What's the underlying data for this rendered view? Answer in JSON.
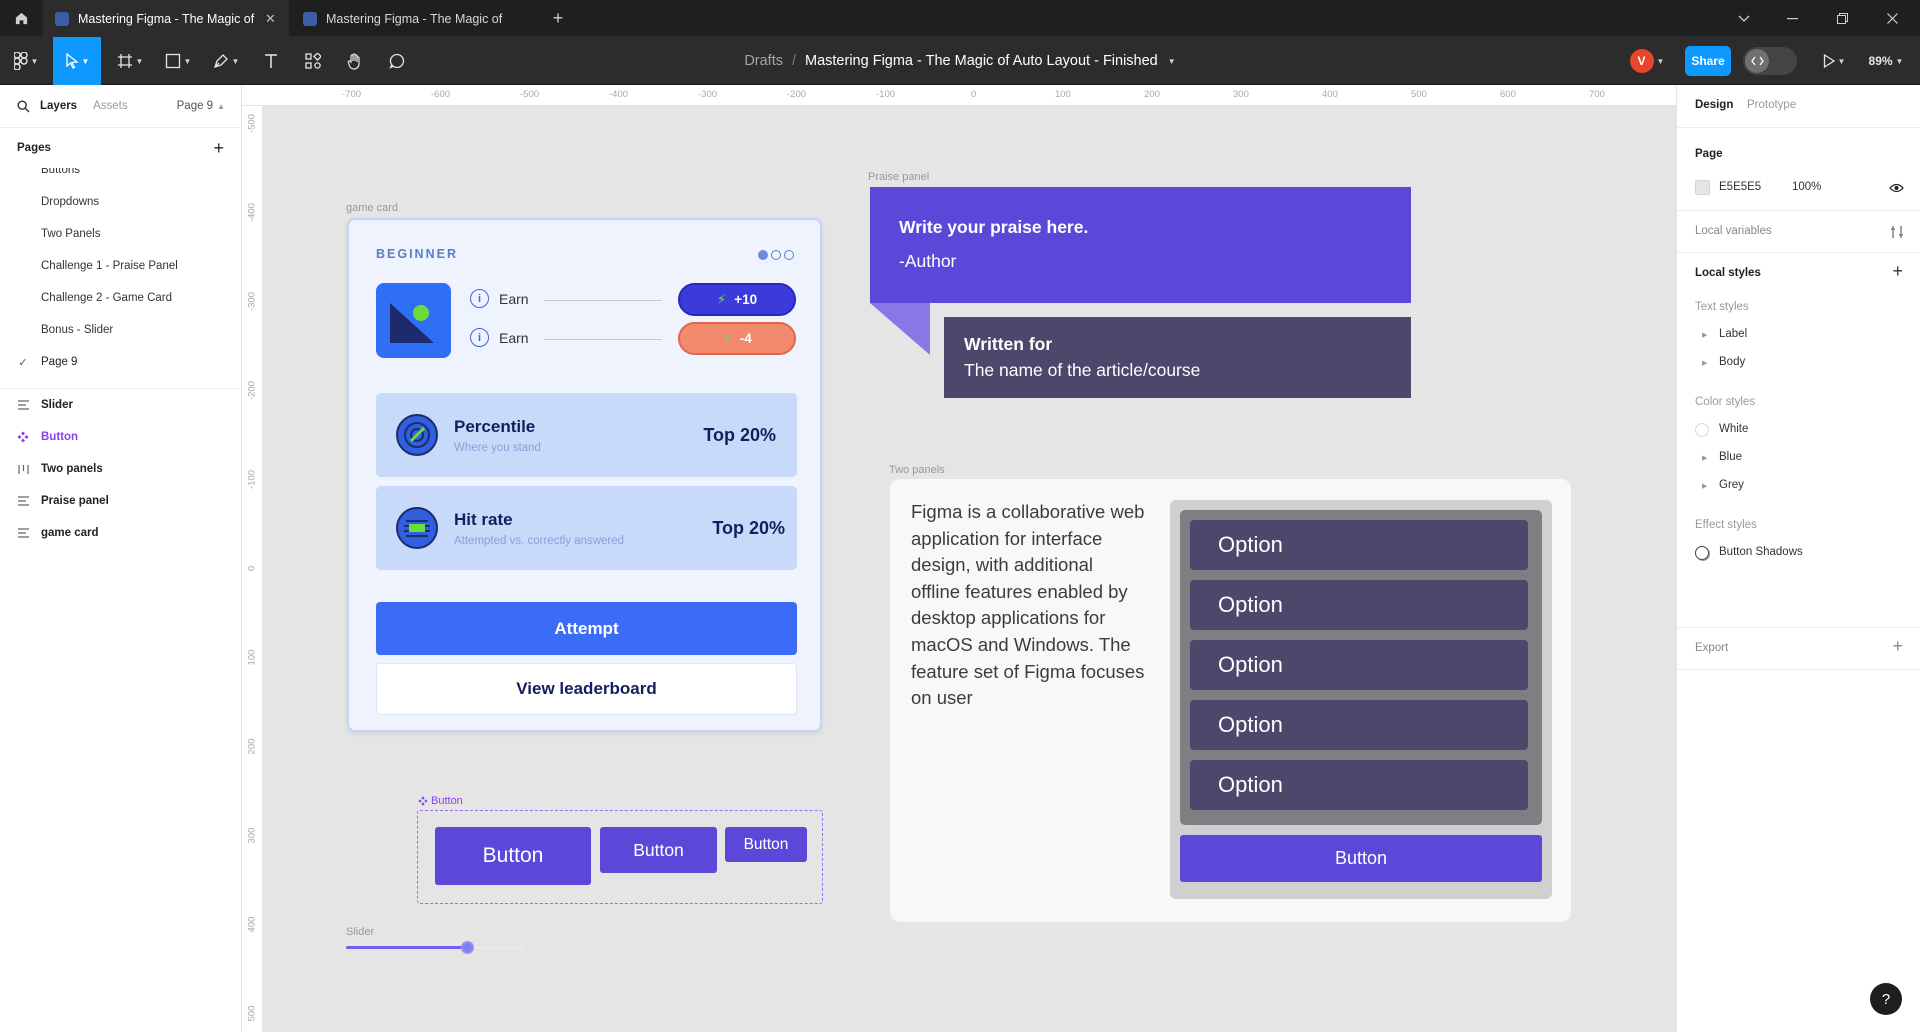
{
  "tabs": [
    {
      "title": "Mastering Figma - The Magic of Au",
      "active": true
    },
    {
      "title": "Mastering Figma - The Magic of Auto",
      "active": false
    }
  ],
  "breadcrumb": {
    "parent": "Drafts",
    "file": "Mastering Figma - The Magic of Auto Layout - Finished"
  },
  "toolbar": {
    "avatar_initial": "V",
    "share_label": "Share",
    "zoom": "89%"
  },
  "left_panel": {
    "tab_layers": "Layers",
    "tab_assets": "Assets",
    "page_selector": "Page 9",
    "pages_heading": "Pages",
    "pages": [
      "Buttons",
      "Dropdowns",
      "Two Panels",
      "Challenge 1 - Praise Panel",
      "Challenge 2 - Game Card",
      "Bonus - Slider",
      "Page 9"
    ],
    "current_page": "Page 9",
    "layers": [
      {
        "label": "Slider",
        "icon": "frame-lines-icon"
      },
      {
        "label": "Button",
        "icon": "component-icon"
      },
      {
        "label": "Two panels",
        "icon": "columns-icon"
      },
      {
        "label": "Praise panel",
        "icon": "frame-lines-icon"
      },
      {
        "label": "game card",
        "icon": "frame-lines-icon"
      }
    ]
  },
  "rulers": {
    "top": [
      "-700",
      "-600",
      "-500",
      "-400",
      "-300",
      "-200",
      "-100",
      "0",
      "100",
      "200",
      "300",
      "400",
      "500",
      "600",
      "700"
    ],
    "left": [
      "-500",
      "-400",
      "-300",
      "-200",
      "-100",
      "0",
      "100",
      "200",
      "300",
      "400",
      "500"
    ]
  },
  "canvas": {
    "game_card": {
      "frame_label": "game card",
      "level": "BEGINNER",
      "earn_rows": [
        {
          "label": "Earn",
          "value": "+10",
          "color": "#3b3bdc"
        },
        {
          "label": "Earn",
          "value": "-4",
          "color": "#f28a6e"
        }
      ],
      "stats": [
        {
          "title": "Percentile",
          "subtitle": "Where you stand",
          "value": "Top 20%"
        },
        {
          "title": "Hit rate",
          "subtitle": "Attempted vs. correctly answered",
          "value": "Top 20%"
        }
      ],
      "primary_button": "Attempt",
      "secondary_button": "View leaderboard"
    },
    "praise_panel": {
      "frame_label": "Praise panel",
      "quote": "Write your praise here.",
      "author": "-Author",
      "written_for": "Written for",
      "target": "The name of the article/course"
    },
    "two_panels": {
      "frame_label": "Two panels",
      "text": "Figma is a collaborative web application for interface design, with additional offline features enabled by desktop applications for macOS and Windows. The feature set of Figma focuses on user",
      "options": [
        "Option",
        "Option",
        "Option",
        "Option",
        "Option"
      ],
      "button": "Button"
    },
    "button_component": {
      "frame_label": "Button",
      "buttons": [
        "Button",
        "Button",
        "Button"
      ]
    },
    "slider": {
      "frame_label": "Slider",
      "value": 0.68
    }
  },
  "right_panel": {
    "tab_design": "Design",
    "tab_prototype": "Prototype",
    "page_heading": "Page",
    "page_color": "E5E5E5",
    "page_opacity": "100%",
    "local_variables": "Local variables",
    "local_styles": "Local styles",
    "text_styles_heading": "Text styles",
    "text_styles": [
      "Label",
      "Body"
    ],
    "color_styles_heading": "Color styles",
    "color_styles": [
      "White",
      "Blue",
      "Grey"
    ],
    "effect_styles_heading": "Effect styles",
    "effect_styles": [
      "Button Shadows"
    ],
    "export": "Export"
  },
  "colors": {
    "accent": "#0d99ff",
    "canvas_bg": "#E5E5E5",
    "purple": "#5b48d9",
    "dark_purple": "#4f466c",
    "blue": "#3b6cf7"
  },
  "help_label": "?"
}
